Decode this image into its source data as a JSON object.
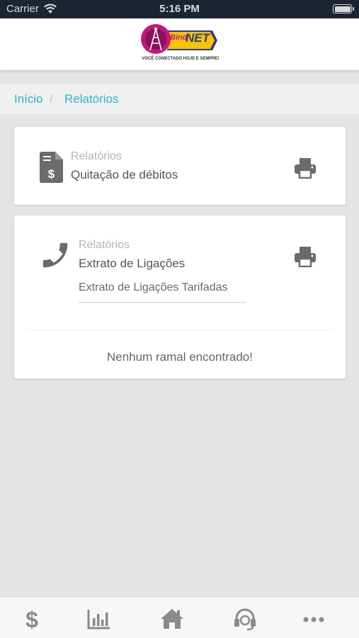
{
  "status_bar": {
    "carrier": "Carrier",
    "time": "5:16 PM"
  },
  "header": {
    "logo_icon": "bindnet-logo",
    "logo_text_main": "NET",
    "logo_text_prefix": "Bind",
    "logo_tagline": "VOCÊ CONECTADO HOJE E SEMPRE!",
    "brand_color": "#c2187a",
    "brand_accent": "#2f3a8f"
  },
  "breadcrumb": {
    "home": "Início",
    "separator": "/",
    "current": "Relatórios",
    "link_color": "#2bb5c8"
  },
  "cards": [
    {
      "icon": "invoice-dollar-icon",
      "category": "Relatórios",
      "title": "Quitação de débitos",
      "action_icon": "print-icon"
    },
    {
      "icon": "phone-icon",
      "category": "Relatórios",
      "title": "Extrato de Ligações",
      "select_value": "Extrato de Ligações Tarifadas",
      "action_icon": "print-icon",
      "empty_message": "Nenhum ramal encontrado!"
    }
  ],
  "tabbar": {
    "items": [
      {
        "icon": "dollar-icon"
      },
      {
        "icon": "bar-chart-icon"
      },
      {
        "icon": "home-icon"
      },
      {
        "icon": "headset-icon"
      },
      {
        "icon": "more-icon"
      }
    ],
    "icon_color": "#8a8a8a"
  }
}
